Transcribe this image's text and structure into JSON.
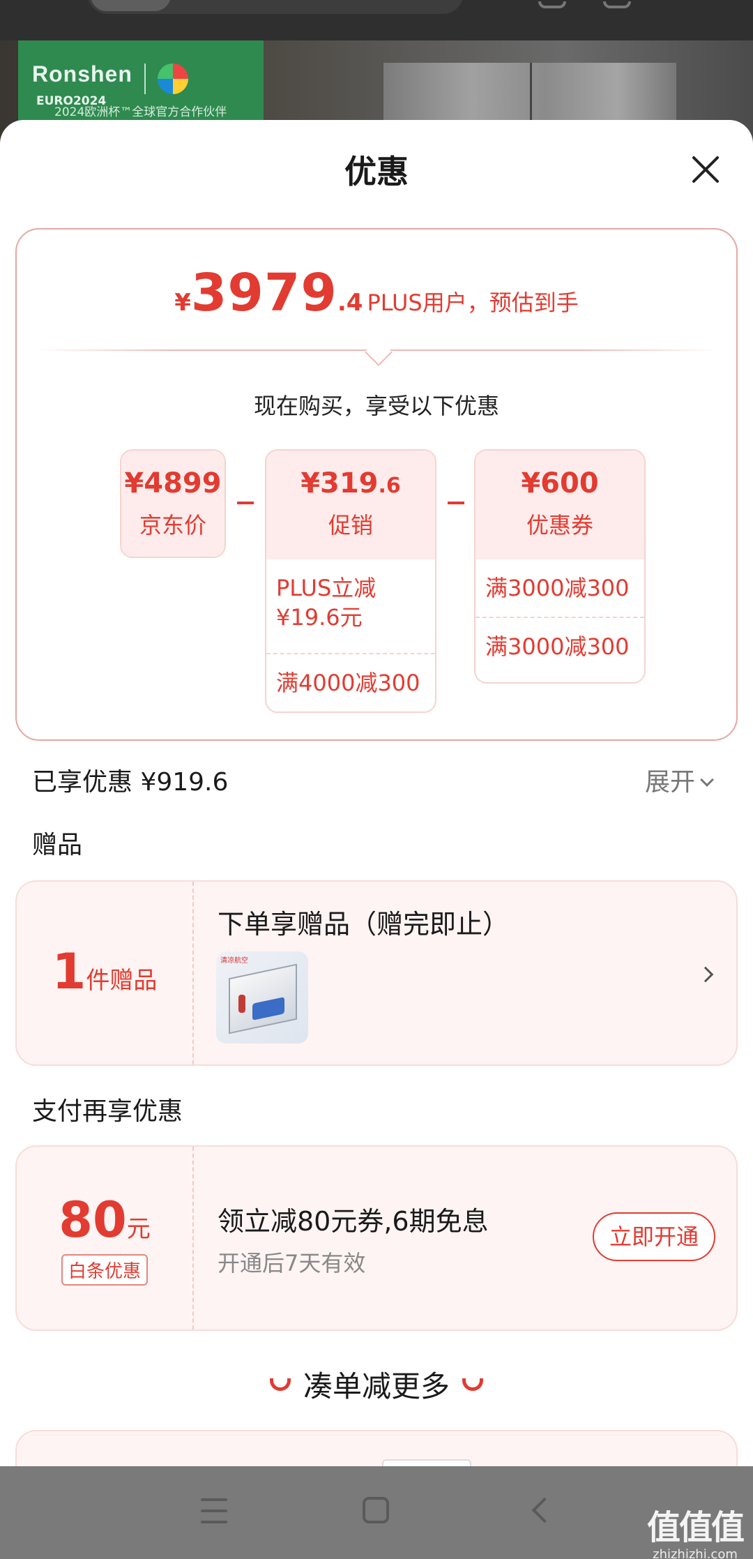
{
  "background": {
    "brand_name": "Ronshen",
    "brand_badge": "EURO2024",
    "brand_tagline": "2024欧洲杯™全球官方合作伙伴"
  },
  "sheet": {
    "title": "优惠",
    "close_icon": "close-icon"
  },
  "estimate": {
    "currency": "¥",
    "price_integer": "3979",
    "price_decimal": ".4",
    "label": "PLUS用户，预估到手",
    "subtitle": "现在购买，享受以下优惠"
  },
  "breakdown": {
    "jd_price": {
      "amount": "¥4899",
      "label": "京东价"
    },
    "promotion": {
      "amount_main": "¥319",
      "amount_decimal": ".6",
      "label": "促销",
      "items": [
        "PLUS立减\n¥19.6元",
        "满4000减300"
      ]
    },
    "coupon": {
      "amount": "¥600",
      "label": "优惠券",
      "items": [
        "满3000减300",
        "满3000减300"
      ]
    }
  },
  "enjoyed": {
    "label": "已享优惠 ¥919.6",
    "expand_label": "展开"
  },
  "gifts": {
    "section_title": "赠品",
    "count": "1",
    "count_unit": "件赠品",
    "title": "下单享赠品（赠完即止）",
    "thumb_tag": "清凉航空"
  },
  "payment": {
    "section_title": "支付再享优惠",
    "amount": "80",
    "unit": "元",
    "badge": "白条优惠",
    "title": "领立减80元券,6期免息",
    "subtitle": "开通后7天有效",
    "button": "立即开通"
  },
  "more": {
    "title": "凑单减更多"
  },
  "watermark": {
    "main": "值值值",
    "sub": "zhizhizhi.com"
  },
  "colors": {
    "accent": "#e23b31",
    "ticket_bg": "#fef4f3",
    "nav_bg": "#7a7a7a"
  }
}
